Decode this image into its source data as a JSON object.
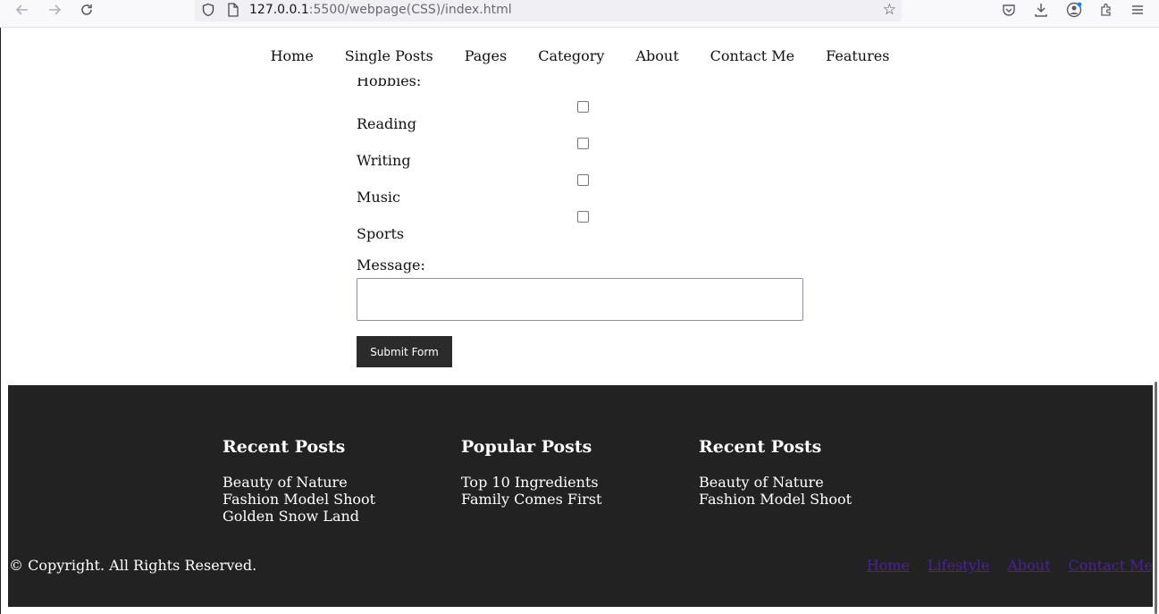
{
  "browser": {
    "url_host": "127.0.0.1",
    "url_rest": ":5500/webpage(CSS)/index.html",
    "icons": [
      "back-arrow-icon",
      "forward-arrow-icon",
      "reload-icon",
      "shield-icon",
      "page-icon",
      "bookmark-star-icon",
      "pocket-icon",
      "download-icon",
      "account-icon",
      "extensions-icon",
      "menu-icon"
    ]
  },
  "nav": {
    "items": [
      "Home",
      "Single Posts",
      "Pages",
      "Category",
      "About",
      "Contact Me",
      "Features"
    ]
  },
  "form": {
    "hobbies_label": "Hobbies:",
    "hobbies": [
      {
        "label": "Reading",
        "checked": false
      },
      {
        "label": "Writing",
        "checked": false
      },
      {
        "label": "Music",
        "checked": false
      },
      {
        "label": "Sports",
        "checked": false
      }
    ],
    "message_label": "Message:",
    "message_value": "",
    "submit_label": "Submit Form"
  },
  "footer": {
    "columns": [
      {
        "title": "Recent Posts",
        "links": [
          "Beauty of Nature",
          "Fashion Model Shoot",
          "Golden Snow Land"
        ]
      },
      {
        "title": "Popular Posts",
        "links": [
          "Top 10 Ingredients",
          "Family Comes First"
        ]
      },
      {
        "title": "Recent Posts",
        "links": [
          "Beauty of Nature",
          "Fashion Model Shoot"
        ]
      }
    ],
    "copyright": "© Copyright. All Rights Reserved.",
    "bottom_links": [
      "Home",
      "Lifestyle",
      "About",
      "Contact Me"
    ]
  },
  "colors": {
    "footer_bg": "#222222",
    "button_bg": "#2b2b2b",
    "footer_link": "#4b1fa3"
  }
}
